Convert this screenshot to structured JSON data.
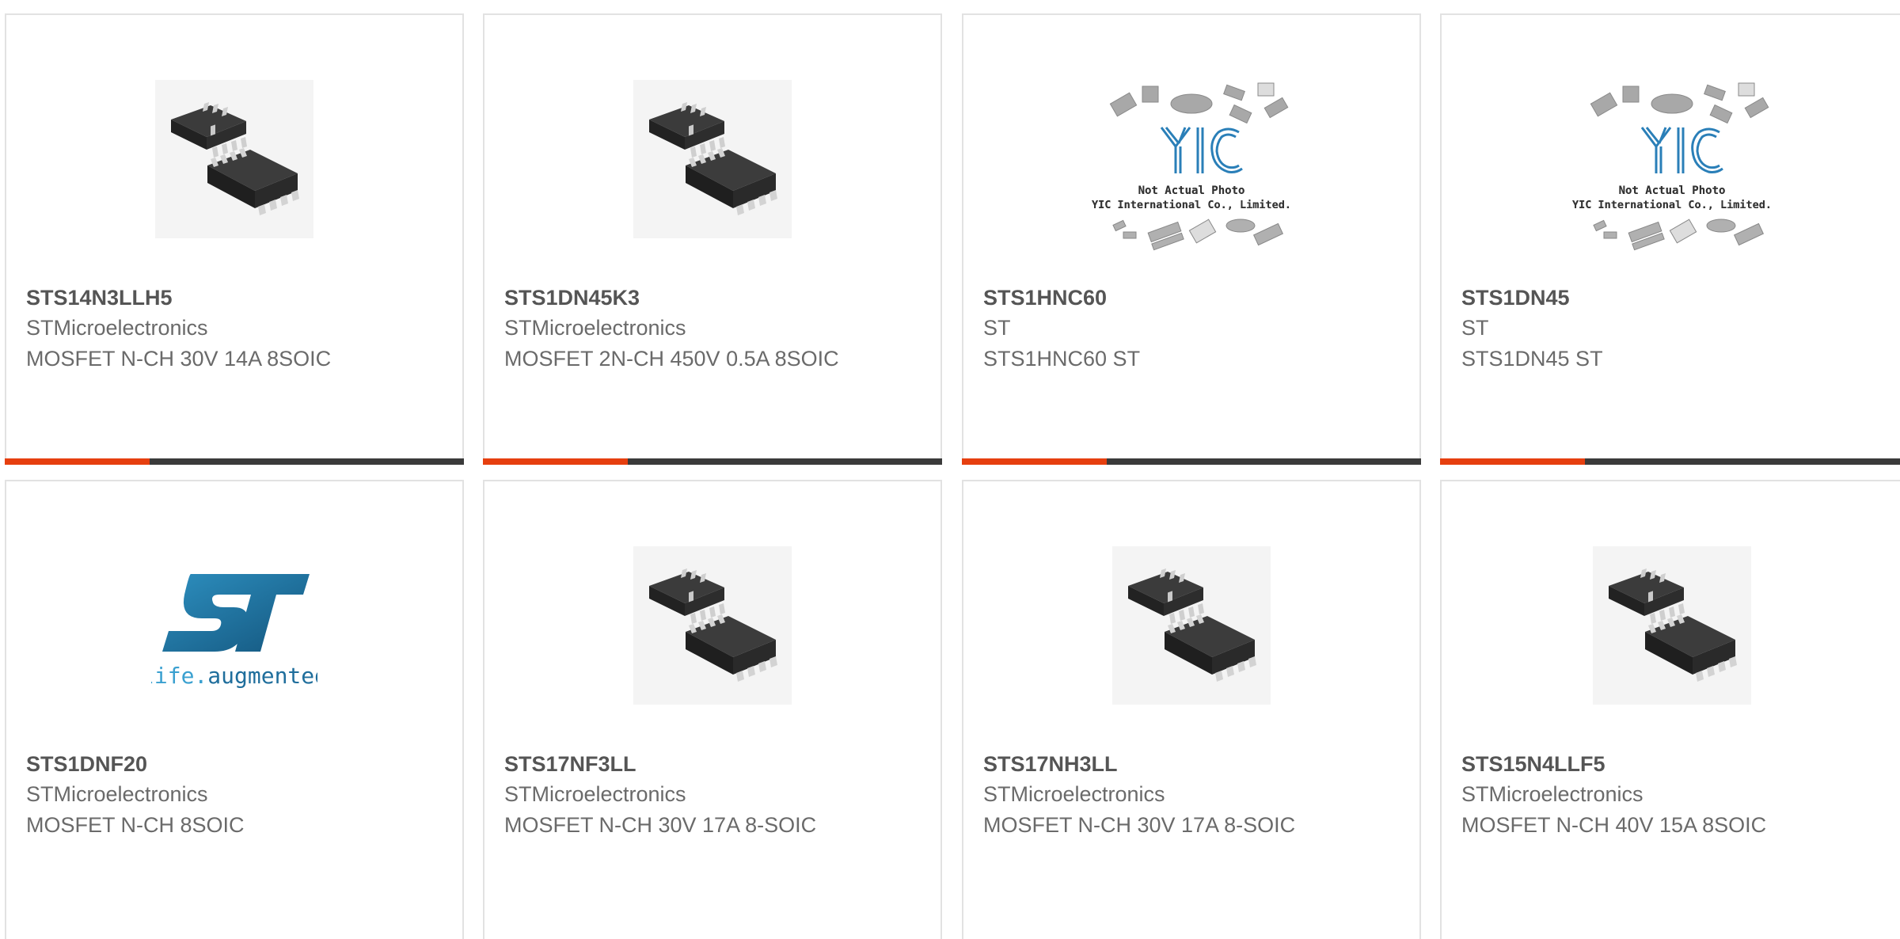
{
  "products": [
    {
      "part": "STS14N3LLH5",
      "manufacturer": "STMicroelectronics",
      "description": "MOSFET N-CH 30V 14A 8SOIC",
      "image": "soic8-chip"
    },
    {
      "part": "STS1DN45K3",
      "manufacturer": "STMicroelectronics",
      "description": "MOSFET 2N-CH 450V 0.5A 8SOIC",
      "image": "soic8-chip"
    },
    {
      "part": "STS1HNC60",
      "manufacturer": "ST",
      "description": "STS1HNC60 ST",
      "image": "yic-placeholder"
    },
    {
      "part": "STS1DN45",
      "manufacturer": "ST",
      "description": "STS1DN45 ST",
      "image": "yic-placeholder"
    },
    {
      "part": "STS1DNF20",
      "manufacturer": "STMicroelectronics",
      "description": "MOSFET N-CH 8SOIC",
      "image": "st-logo"
    },
    {
      "part": "STS17NF3LL",
      "manufacturer": "STMicroelectronics",
      "description": "MOSFET N-CH 30V 17A 8-SOIC",
      "image": "soic8-chip"
    },
    {
      "part": "STS17NH3LL",
      "manufacturer": "STMicroelectronics",
      "description": "MOSFET N-CH 30V 17A 8-SOIC",
      "image": "soic8-chip"
    },
    {
      "part": "STS15N4LLF5",
      "manufacturer": "STMicroelectronics",
      "description": "MOSFET N-CH 40V 15A 8SOIC",
      "image": "soic8-chip"
    }
  ],
  "placeholder": {
    "line1": "Not Actual Photo",
    "line2": "YIC International Co., Limited.",
    "logo_text": "YIC"
  },
  "st_logo": {
    "tagline": "life.augmented",
    "tagline_prefix": "life.",
    "tagline_suffix": "augmented"
  },
  "colors": {
    "accent": "#e63f0f",
    "bar": "#3a3a3a",
    "border": "#e2e2e2",
    "title_text": "#555555",
    "body_text": "#6a6a6a",
    "st_blue": "#1f6e9c"
  }
}
